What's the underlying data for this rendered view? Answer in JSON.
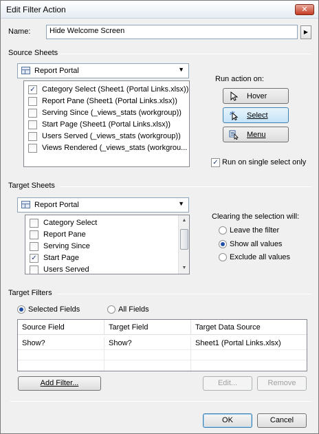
{
  "window": {
    "title": "Edit Filter Action",
    "close_glyph": "✕"
  },
  "name_field": {
    "label": "Name:",
    "value": "Hide Welcome Screen",
    "more_glyph": "▶"
  },
  "source_sheets": {
    "title": "Source Sheets",
    "datasource": "Report Portal",
    "items": [
      {
        "label": "Category Select (Sheet1 (Portal Links.xlsx))",
        "checked": true
      },
      {
        "label": "Report Pane (Sheet1 (Portal Links.xlsx))",
        "checked": false
      },
      {
        "label": "Serving Since (_views_stats (workgroup))",
        "checked": false
      },
      {
        "label": "Start Page (Sheet1 (Portal Links.xlsx))",
        "checked": false
      },
      {
        "label": "Users Served (_views_stats (workgroup))",
        "checked": false
      },
      {
        "label": "Views Rendered (_views_stats (workgrou...",
        "checked": false
      }
    ]
  },
  "run_action": {
    "title": "Run action on:",
    "buttons": [
      {
        "label": "Hover",
        "icon": "pointer-icon",
        "selected": false
      },
      {
        "label": "Select",
        "icon": "select-cursor-icon",
        "selected": true
      },
      {
        "label": "Menu",
        "icon": "menu-icon",
        "selected": false
      }
    ],
    "single_select_label": "Run on single select only",
    "single_select_checked": true
  },
  "target_sheets": {
    "title": "Target Sheets",
    "datasource": "Report Portal",
    "items": [
      {
        "label": "Category Select",
        "checked": false
      },
      {
        "label": "Report Pane",
        "checked": false
      },
      {
        "label": "Serving Since",
        "checked": false
      },
      {
        "label": "Start Page",
        "checked": true
      },
      {
        "label": "Users Served",
        "checked": false
      }
    ]
  },
  "clearing": {
    "title": "Clearing the selection will:",
    "options": [
      {
        "label": "Leave the filter",
        "selected": false
      },
      {
        "label": "Show all values",
        "selected": true
      },
      {
        "label": "Exclude all values",
        "selected": false
      }
    ]
  },
  "target_filters": {
    "title": "Target Filters",
    "selected_fields_label": "Selected Fields",
    "all_fields_label": "All Fields",
    "mode": "selected",
    "columns": [
      "Source Field",
      "Target Field",
      "Target Data Source"
    ],
    "rows": [
      [
        "Show?",
        "Show?",
        "Sheet1 (Portal Links.xlsx)"
      ]
    ]
  },
  "buttons": {
    "add_filter": "Add Filter...",
    "edit": "Edit...",
    "remove": "Remove",
    "ok": "OK",
    "cancel": "Cancel"
  },
  "glyphs": {
    "check": "✓",
    "dropdown": "▼",
    "scroll_up": "▲",
    "scroll_down": "▼"
  }
}
